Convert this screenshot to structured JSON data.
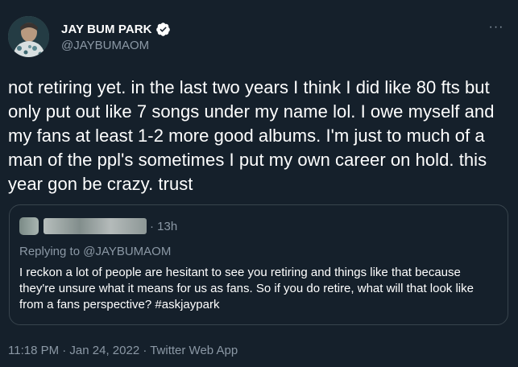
{
  "author": {
    "display_name": "JAY BUM PARK",
    "handle": "@JAYBUMAOM",
    "verified": true,
    "avatar_icon": "profile-photo"
  },
  "more_icon": "ellipsis-icon",
  "more_label": "···",
  "tweet": {
    "text": "not retiring yet. in the last two years I think I did like 80 fts but only put out like 7 songs under my name lol. I owe myself and my fans at least 1-2 more good albums. I'm just to much of a man of the ppl's sometimes I put my own career on hold. this year gon be crazy. trust"
  },
  "quoted_tweet": {
    "time": "· 13h",
    "replying_to_prefix": "Replying to",
    "replying_to_handle": "@JAYBUMAOM",
    "text": "I reckon a lot of people are hesitant to see you retiring and things like that because they're unsure what it means for us as fans. So if you do retire, what will that look like from a fans perspective? #askjaypark"
  },
  "meta": {
    "timestamp": "11:18 PM · Jan 24, 2022 · Twitter Web App"
  },
  "colors": {
    "background": "#15202b",
    "text": "#ffffff",
    "secondary": "#8b98a5",
    "verified": "#ffffff",
    "border": "#38444d"
  }
}
